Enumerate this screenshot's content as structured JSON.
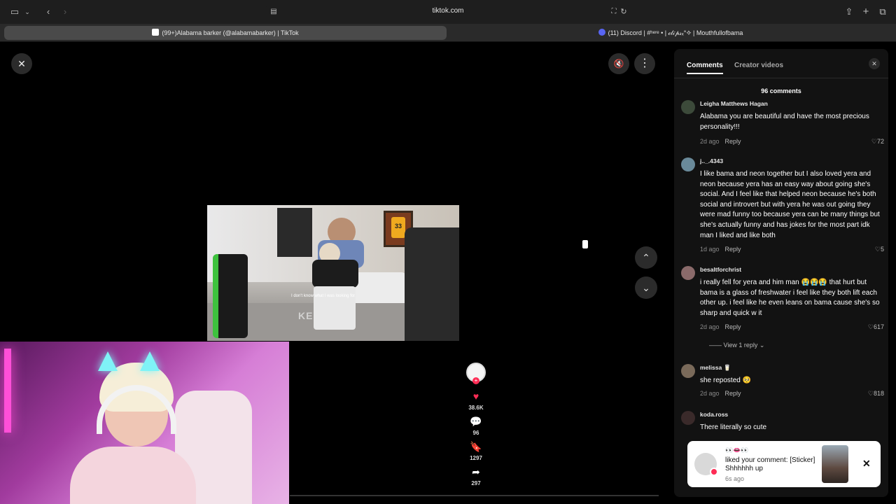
{
  "browser": {
    "url": "tiktok.com",
    "tabs": [
      {
        "title": "(99+)Alabama barker (@alabamabarker) | TikTok",
        "active": true
      },
      {
        "title": "(11) Discord | #ʰᵉʳᵉ • | 𝒸𝓁𝒾𝓅𝓈ₓ°✧ | Mouthfullofbama",
        "active": false
      }
    ]
  },
  "video": {
    "jersey_number": "33",
    "caption": "I don't know what I was looking for",
    "rug_text": "KEEP OFF"
  },
  "actions": {
    "likes": "38.6K",
    "comments": "96",
    "saves": "1297",
    "shares": "297",
    "plus": "+"
  },
  "panel": {
    "tab_comments": "Comments",
    "tab_creator": "Creator videos",
    "count_text": "96 comments",
    "comments": [
      {
        "user": "Leigha Matthews Hagan",
        "text": "Alabama you are beautiful and have the most precious personality!!!",
        "time": "2d ago",
        "reply": "Reply",
        "likes": "72"
      },
      {
        "user": "j.._.4343",
        "text": "I like bama and neon together but I also loved yera and neon because yera has an easy way about going she's social. And I feel like that helped neon because he's both social and introvert but with yera he was out going they were mad funny too because yera can be many things but she's actually funny and has jokes for the most part idk man I liked and like both",
        "time": "1d ago",
        "reply": "Reply",
        "likes": "5"
      },
      {
        "user": "besaltforchrist",
        "text": "i really fell for yera and him man 😭😭😭 that hurt but bama is a glass of freshwater i feel like they both lift each other up. i feel like he even leans on bama cause she's so sharp and quick w it",
        "time": "2d ago",
        "reply": "Reply",
        "likes": "617",
        "view_replies": "View 1 reply"
      },
      {
        "user": "melissa 🥛",
        "text": "she reposted 🥺",
        "time": "2d ago",
        "reply": "Reply",
        "likes": "818"
      },
      {
        "user": "koda.ross",
        "text": "There literally so cute",
        "time": "",
        "reply": "",
        "likes": ""
      }
    ]
  },
  "notification": {
    "emoji": "👀👄👀",
    "text": "liked your comment: [Sticker] Shhhhhh up",
    "time": "6s ago"
  }
}
